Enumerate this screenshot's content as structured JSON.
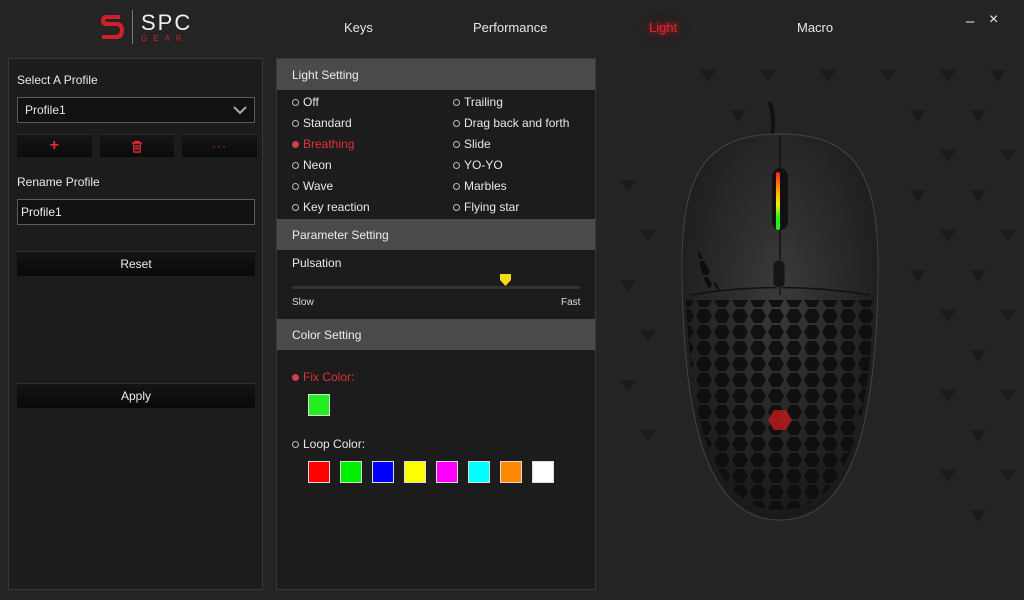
{
  "brand": {
    "spc": "SPC",
    "gear": "GEAR"
  },
  "tabs": [
    {
      "label": "Keys",
      "active": false
    },
    {
      "label": "Performance",
      "active": false
    },
    {
      "label": "Light",
      "active": true
    },
    {
      "label": "Macro",
      "active": false
    }
  ],
  "window": {
    "minimize": "–",
    "close": "×"
  },
  "profile": {
    "select_label": "Select A Profile",
    "selected": "Profile1",
    "add_icon": "+",
    "more_icon": "···",
    "rename_label": "Rename Profile",
    "rename_value": "Profile1",
    "reset_label": "Reset",
    "apply_label": "Apply"
  },
  "light_setting": {
    "title": "Light Setting",
    "modes_left": [
      "Off",
      "Standard",
      "Breathing",
      "Neon",
      "Wave",
      "Key reaction"
    ],
    "modes_right": [
      "Trailing",
      "Drag back and forth",
      "Slide",
      "YO-YO",
      "Marbles",
      "Flying star"
    ],
    "selected": "Breathing"
  },
  "parameter_setting": {
    "title": "Parameter Setting",
    "param_label": "Pulsation",
    "min_label": "Slow",
    "max_label": "Fast",
    "value_fraction": 0.74
  },
  "color_setting": {
    "title": "Color Setting",
    "fix_label": "Fix Color:",
    "loop_label": "Loop Color:",
    "fix_color": "#22ee22",
    "loop_colors": [
      "#ff0000",
      "#00ee00",
      "#0000ff",
      "#ffff00",
      "#ff00ff",
      "#00ffff",
      "#ff8800",
      "#ffffff"
    ],
    "selected_mode": "fix"
  },
  "accent_color": "#e02834"
}
